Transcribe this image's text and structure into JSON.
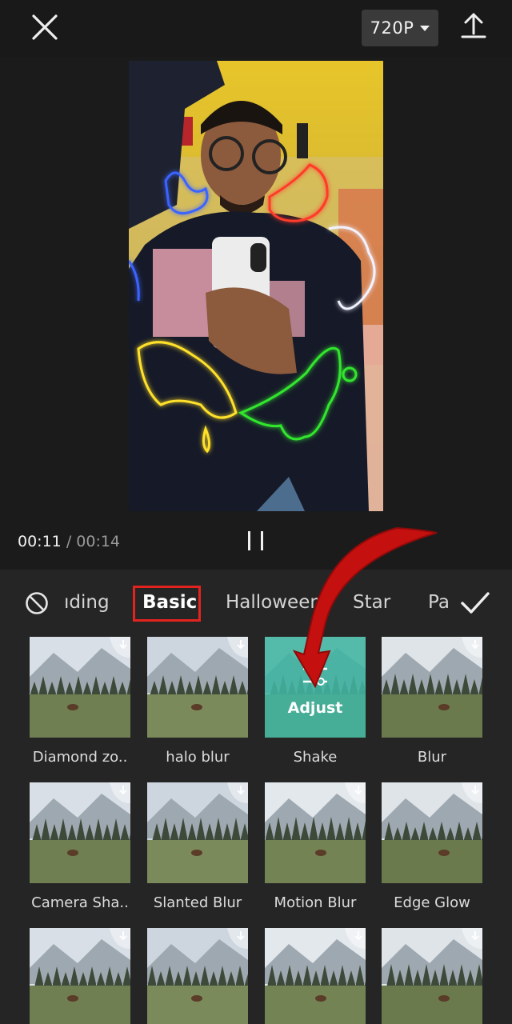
{
  "topbar": {
    "resolution_label": "720P",
    "close_icon": "close-icon",
    "export_icon": "upload-icon"
  },
  "playback": {
    "current_time": "00:11",
    "separator": "/",
    "total_time": "00:14"
  },
  "categories": {
    "tabs": [
      {
        "label": "ıding",
        "active": false
      },
      {
        "label": "Basic",
        "active": true
      },
      {
        "label": "Halloween",
        "active": false
      },
      {
        "label": "Star",
        "active": false
      },
      {
        "label": "Pa",
        "active": false
      }
    ]
  },
  "effects": [
    {
      "label": "Diamond zo..",
      "downloadable": true
    },
    {
      "label": "halo blur",
      "downloadable": true
    },
    {
      "label": "Shake",
      "selected": true,
      "overlay_label": "Adjust"
    },
    {
      "label": "Blur",
      "downloadable": true
    },
    {
      "label": "Camera Sha..",
      "downloadable": true
    },
    {
      "label": "Slanted Blur",
      "downloadable": true
    },
    {
      "label": "Motion Blur",
      "downloadable": true
    },
    {
      "label": "Edge Glow",
      "downloadable": true
    },
    {
      "label": "",
      "downloadable": true
    },
    {
      "label": "",
      "downloadable": true
    },
    {
      "label": "",
      "downloadable": true
    },
    {
      "label": "",
      "downloadable": true
    }
  ],
  "colors": {
    "highlight_box": "#e3231e",
    "annotation_arrow": "#c4100f",
    "selected_tile": "#40b4a0"
  }
}
